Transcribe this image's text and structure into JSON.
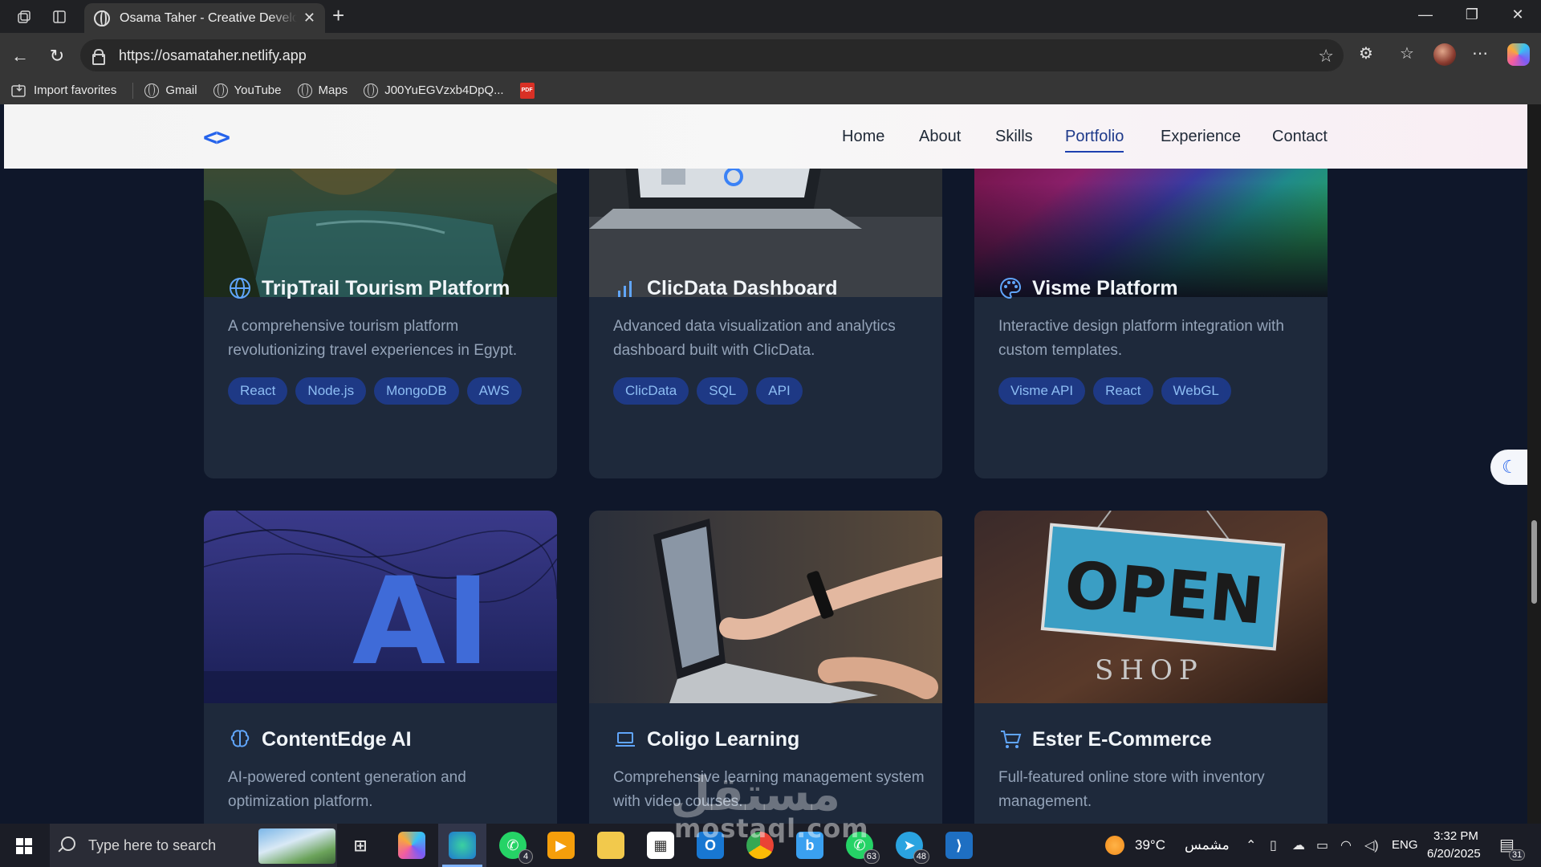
{
  "browser": {
    "tab_title": "Osama Taher - Creative Developer",
    "url": "https://osamataher.netlify.app",
    "bookmarks": [
      {
        "label": "Import favorites"
      },
      {
        "label": "Gmail"
      },
      {
        "label": "YouTube"
      },
      {
        "label": "Maps"
      },
      {
        "label": "J00YuEGVzxb4DpQ..."
      }
    ],
    "pdf_label": "PDF"
  },
  "site": {
    "logo": "<>",
    "nav": [
      {
        "label": "Home"
      },
      {
        "label": "About"
      },
      {
        "label": "Skills"
      },
      {
        "label": "Portfolio",
        "active": true
      },
      {
        "label": "Experience"
      },
      {
        "label": "Contact"
      }
    ],
    "projects": [
      {
        "title": "TripTrail Tourism Platform",
        "icon": "globe-icon",
        "description": "A comprehensive tourism platform revolutionizing travel experiences in Egypt.",
        "tags": [
          "React",
          "Node.js",
          "MongoDB",
          "AWS"
        ]
      },
      {
        "title": "ClicData Dashboard",
        "icon": "bar-chart-icon",
        "description": "Advanced data visualization and analytics dashboard built with ClicData.",
        "tags": [
          "ClicData",
          "SQL",
          "API"
        ]
      },
      {
        "title": "Visme Platform",
        "icon": "palette-icon",
        "description": "Interactive design platform integration with custom templates.",
        "tags": [
          "Visme API",
          "React",
          "WebGL"
        ]
      },
      {
        "title": "ContentEdge AI",
        "icon": "brain-icon",
        "description": "AI-powered content generation and optimization platform.",
        "image_text": "AI"
      },
      {
        "title": "Coligo Learning",
        "icon": "laptop-icon",
        "description": "Comprehensive learning management system with video courses."
      },
      {
        "title": "Ester E-Commerce",
        "icon": "cart-icon",
        "description": "Full-featured online store with inventory management.",
        "image_text": "OPEN",
        "image_subtext": "SHOP"
      }
    ]
  },
  "taskbar": {
    "search_placeholder": "Type here to search",
    "whatsapp_badge": "4",
    "whatsapp2_badge": "63",
    "telegram_badge": "48",
    "weather": "39°C",
    "weather_label": "مشمس",
    "language": "ENG",
    "time": "3:32 PM",
    "date": "6/20/2025",
    "notifications": "31"
  },
  "watermark": {
    "arabic": "مستقل",
    "latin": "mostaql.com"
  },
  "colors": {
    "accent": "#2563eb",
    "card_bg": "#1e293b",
    "page_bg": "#0f172a",
    "tag_bg": "#1e3a8a",
    "tag_text": "#93c5fd"
  }
}
